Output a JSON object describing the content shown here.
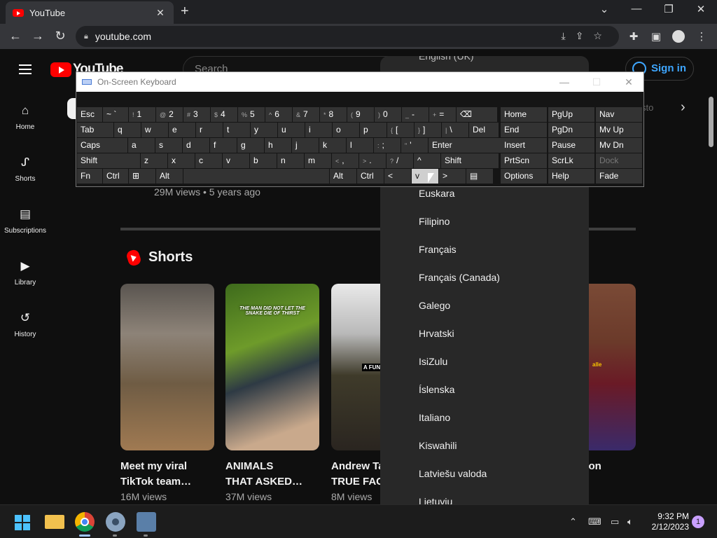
{
  "browser": {
    "tab_title": "YouTube",
    "url": "youtube.com"
  },
  "youtube": {
    "logo_text": "YouTube",
    "search_placeholder": "Search",
    "signin_label": "Sign in",
    "chip_right_fragment": "sto",
    "guide": [
      "Home",
      "Shorts",
      "Subscriptions",
      "Library",
      "History"
    ],
    "video_meta": "29M views • 5 years ago",
    "shorts_title": "Shorts",
    "shorts": [
      {
        "title_l1": "Meet my viral",
        "title_l2": "TikTok team…",
        "views": "16M views"
      },
      {
        "title_l1": "ANIMALS",
        "title_l2": "THAT ASKED…",
        "views": "37M views",
        "overlay": "THE MAN DID NOT LET THE SNAKE DIE OF THIRST"
      },
      {
        "title_l1": "Andrew Ta",
        "title_l2": "TRUE FAC",
        "views": "8M views",
        "overlay": "A FUN"
      },
      {
        "title_l1": "k iron",
        "title_l2": "",
        "views": "",
        "overlay": "alle"
      }
    ]
  },
  "language_menu": {
    "partial_top": "English (UK)",
    "items": [
      "Euskara",
      "Filipino",
      "Français",
      "Français (Canada)",
      "Galego",
      "Hrvatski",
      "IsiZulu",
      "Íslenska",
      "Italiano",
      "Kiswahili",
      "Latviešu valoda",
      "Lietuvių"
    ]
  },
  "osk": {
    "title": "On-Screen Keyboard",
    "rows": [
      [
        [
          "Esc",
          ""
        ],
        [
          "~ `",
          ""
        ],
        [
          "1",
          "!"
        ],
        [
          "2",
          "@"
        ],
        [
          "3",
          "#"
        ],
        [
          "4",
          "$"
        ],
        [
          "5",
          "%"
        ],
        [
          "6",
          "^"
        ],
        [
          "7",
          "&"
        ],
        [
          "8",
          "*"
        ],
        [
          "9",
          "("
        ],
        [
          "0",
          ")"
        ],
        [
          "-",
          "_"
        ],
        [
          "=",
          "+"
        ],
        [
          "⌫",
          ""
        ]
      ],
      [
        [
          "Tab",
          ""
        ],
        [
          "q",
          ""
        ],
        [
          "w",
          ""
        ],
        [
          "e",
          ""
        ],
        [
          "r",
          ""
        ],
        [
          "t",
          ""
        ],
        [
          "y",
          ""
        ],
        [
          "u",
          ""
        ],
        [
          "i",
          ""
        ],
        [
          "o",
          ""
        ],
        [
          "p",
          ""
        ],
        [
          "[",
          "{"
        ],
        [
          "]",
          "}"
        ],
        [
          "\\",
          "|"
        ],
        [
          "Del",
          ""
        ]
      ],
      [
        [
          "Caps",
          ""
        ],
        [
          "a",
          ""
        ],
        [
          "s",
          ""
        ],
        [
          "d",
          ""
        ],
        [
          "f",
          ""
        ],
        [
          "g",
          ""
        ],
        [
          "h",
          ""
        ],
        [
          "j",
          ""
        ],
        [
          "k",
          ""
        ],
        [
          "l",
          ""
        ],
        [
          ";",
          ":"
        ],
        [
          "'",
          "\""
        ],
        [
          "Enter",
          ""
        ]
      ],
      [
        [
          "Shift",
          ""
        ],
        [
          "z",
          ""
        ],
        [
          "x",
          ""
        ],
        [
          "c",
          ""
        ],
        [
          "v",
          ""
        ],
        [
          "b",
          ""
        ],
        [
          "n",
          ""
        ],
        [
          "m",
          ""
        ],
        [
          ",",
          "<"
        ],
        [
          ".",
          ">"
        ],
        [
          "/",
          "?"
        ],
        [
          "^",
          ""
        ],
        [
          "Shift",
          ""
        ]
      ],
      [
        [
          "Fn",
          ""
        ],
        [
          "Ctrl",
          ""
        ],
        [
          "⊞",
          ""
        ],
        [
          "Alt",
          ""
        ],
        [
          "",
          ""
        ],
        [
          "Alt",
          ""
        ],
        [
          "Ctrl",
          ""
        ],
        [
          "<",
          ""
        ],
        [
          "v",
          ""
        ],
        [
          ">",
          ""
        ],
        [
          "▤",
          ""
        ]
      ]
    ],
    "nav_keys": [
      [
        "Home",
        "PgUp",
        "Nav"
      ],
      [
        "End",
        "PgDn",
        "Mv Up"
      ],
      [
        "Insert",
        "Pause",
        "Mv Dn"
      ],
      [
        "PrtScn",
        "ScrLk",
        "Dock"
      ],
      [
        "Options",
        "Help",
        "Fade"
      ]
    ]
  },
  "taskbar": {
    "time": "9:32 PM",
    "date": "2/12/2023",
    "notifications": "1"
  },
  "colors": {
    "yt_red": "#ff0000",
    "signin_blue": "#3ea6ff",
    "bg": "#0f0f0f"
  }
}
